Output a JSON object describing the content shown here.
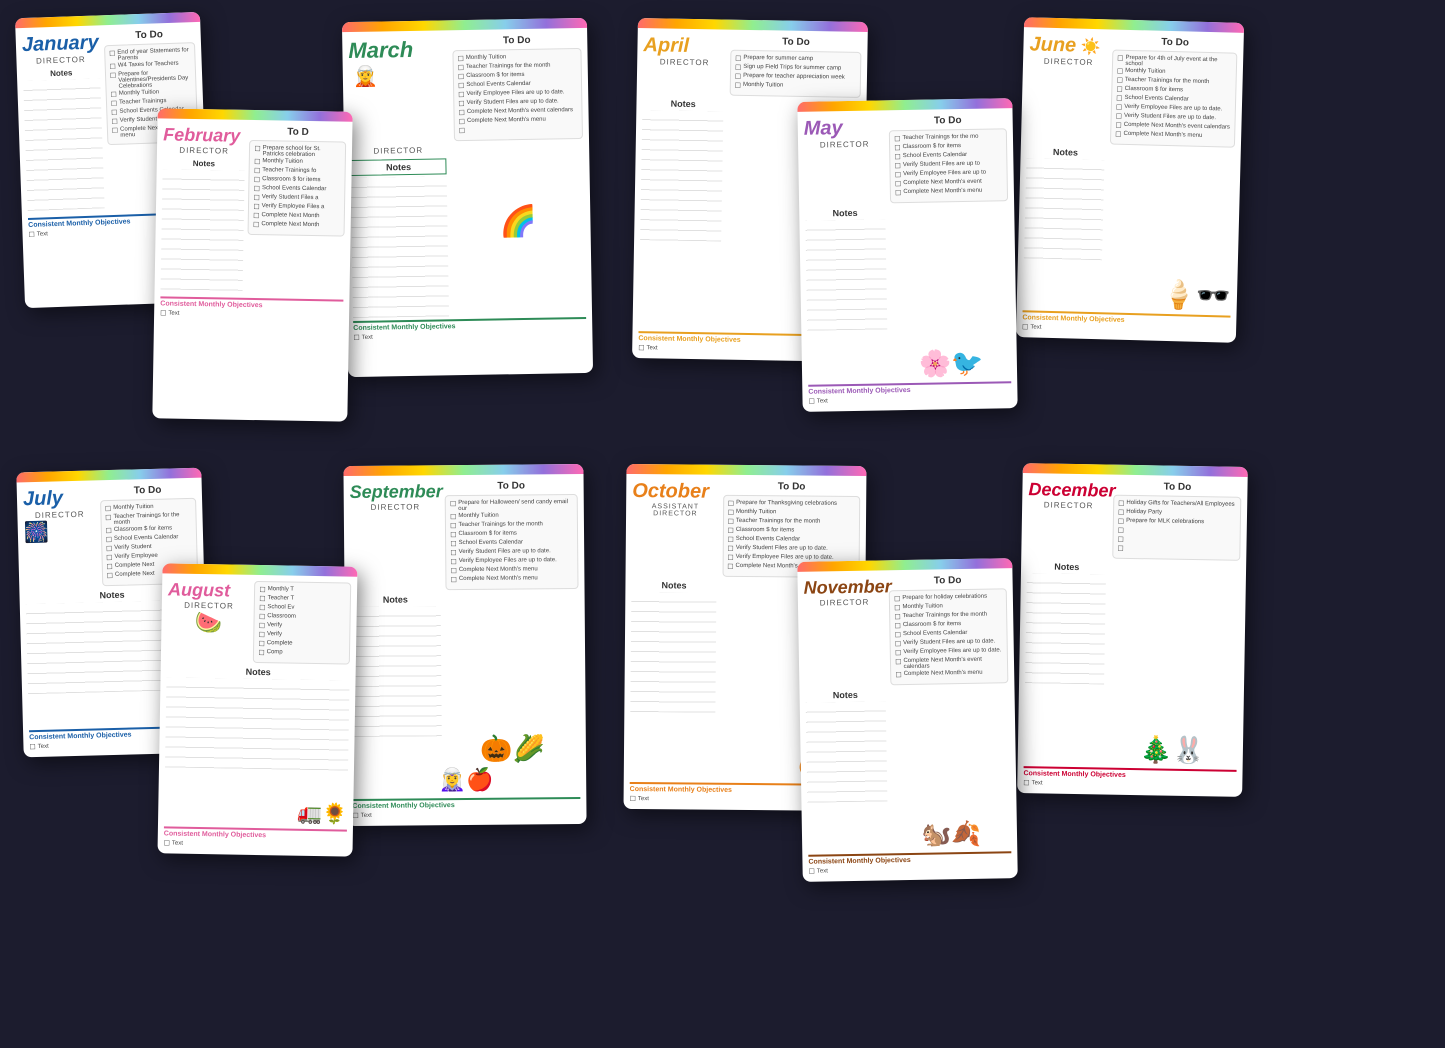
{
  "months": [
    {
      "id": "jan",
      "name": "January",
      "role": "DIRECTOR",
      "color": "#1a5fa8",
      "accent": "jan-accent",
      "objColor": "obj-jan",
      "icon": "❄️",
      "todoItems": [
        "End of year Statements for Parents",
        "W4 Taxes for Teachers",
        "Prepare for Valentines/Presidents Day Celebrations",
        "Monthly Tuition",
        "Teacher Trainings",
        "School Events Calendar",
        "Verify Student Files",
        "Complete Next Month's menu"
      ],
      "objectives": "Text"
    },
    {
      "id": "feb",
      "name": "February",
      "role": "DIRECTOR",
      "color": "#e05c9c",
      "accent": "feb-accent",
      "objColor": "obj-feb",
      "icon": "💕",
      "todoItems": [
        "Prepare school for St. Patrick's Day celebration/black his",
        "Monthly Tuition",
        "Teacher Trainings for",
        "Classroom $ for items",
        "School Events Calendar",
        "Verify Student Files a",
        "Verify Employee Files a",
        "Complete Next Month",
        "Complete Next Month"
      ],
      "objectives": "Text"
    },
    {
      "id": "mar",
      "name": "March",
      "role": "DIRECTOR",
      "color": "#2e8b57",
      "accent": "mar-accent",
      "objColor": "obj-mar",
      "icon": "🍀",
      "todoItems": [
        "Monthly Tuition",
        "Teacher Trainings for the month",
        "Classroom $ for items",
        "School Events Calendar",
        "Verify Employee Files are up to date.",
        "Verify Student Files are up to date.",
        "Complete Next Month's event calendars",
        "Complete Next Month's menu"
      ],
      "objectives": "Text"
    },
    {
      "id": "apr",
      "name": "April",
      "role": "DIRECTOR",
      "color": "#e8a020",
      "accent": "apr-accent",
      "objColor": "obj-apr",
      "icon": "🌸",
      "todoItems": [
        "Prepare for summer camp",
        "Sign up Field Trips for summer camp",
        "Prepare for teacher appreciation week",
        "Monthly Tuition"
      ],
      "objectives": "Text"
    },
    {
      "id": "may",
      "name": "May",
      "role": "DIRECTOR",
      "color": "#9b59b6",
      "accent": "may-accent",
      "objColor": "obj-may",
      "icon": "🌻",
      "todoItems": [
        "Teacher Trainings for the mo",
        "Classroom $ for items",
        "School Events Calendar",
        "Verify Student Files are up to",
        "Verify Employee Files are up to",
        "Complete Next Month's event",
        "Complete Next Month's menu"
      ],
      "objectives": "Text"
    },
    {
      "id": "jun",
      "name": "June",
      "role": "DIRECTOR",
      "color": "#e8a020",
      "accent": "jun-accent",
      "objColor": "obj-jun",
      "icon": "☀️",
      "todoItems": [
        "Prepare for 4th of July event at the school",
        "Monthly Tuition",
        "Teacher Trainings for the month",
        "Classroom $ for items",
        "School Events Calendar",
        "Verify Employee Files are up to date.",
        "Verify Student Files are up to date.",
        "Complete Next Month's event calendars",
        "Complete Next Month's menu"
      ],
      "objectives": "Text"
    },
    {
      "id": "jul",
      "name": "July",
      "role": "DIRECTOR",
      "color": "#1a5fa8",
      "accent": "jul-accent",
      "objColor": "obj-jul",
      "icon": "🎆",
      "todoItems": [
        "Monthly Tuition",
        "Teacher Trainings for the month",
        "Classroom $ for items",
        "School Events Calendar",
        "Verify Student",
        "Verify Employee",
        "Complete Next",
        "Complete Next"
      ],
      "objectives": "Text"
    },
    {
      "id": "aug",
      "name": "August",
      "role": "DIRECTOR",
      "color": "#e05c9c",
      "accent": "aug-accent",
      "objColor": "obj-aug",
      "icon": "🍉",
      "todoItems": [
        "Monthly T",
        "Teacher T",
        "School Ev",
        "Classroom",
        "Verify",
        "Verify",
        "Complete",
        "Comp"
      ],
      "objectives": "Text"
    },
    {
      "id": "sep",
      "name": "September",
      "role": "DIRECTOR",
      "color": "#2e8b57",
      "accent": "sep-accent",
      "objColor": "obj-sep",
      "icon": "🎃",
      "todoItems": [
        "Prepare for Halloween/ send candy email our",
        "Monthly Tuition",
        "Teacher Trainings for the month",
        "Classroom $ for items",
        "School Events Calendar",
        "Verify Student Files are up to date.",
        "Verify Employee Files are up to date.",
        "Complete Next Month's menu",
        "Complete Next Month's menu"
      ],
      "objectives": "Text"
    },
    {
      "id": "oct",
      "name": "October",
      "role": "ASSISTANT DIRECTOR",
      "color": "#e8801a",
      "accent": "oct-accent",
      "objColor": "obj-oct",
      "icon": "🎃",
      "todoItems": [
        "Prepare for Thanksgiving celebrations",
        "Monthly Tuition",
        "Teacher Trainings for the month",
        "Classroom $ for items",
        "School Events Calendar",
        "Verify Student Files are up to date.",
        "Verify Employee Files are up to date.",
        "Complete Next Month's event calendars"
      ],
      "objectives": "Text"
    },
    {
      "id": "nov",
      "name": "November",
      "role": "DIRECTOR",
      "color": "#8B4513",
      "accent": "nov-accent",
      "objColor": "obj-nov",
      "icon": "🍂",
      "todoItems": [
        "Prepare for holiday celebrations",
        "Monthly Tuition",
        "Teacher Trainings for the month",
        "Classroom $ for items",
        "School Events Calendar",
        "Verify Student Files are up to date.",
        "Verify Employee Files are up to date.",
        "Complete Next Month's event calendars",
        "Complete Next Month's menu"
      ],
      "objectives": "Text"
    },
    {
      "id": "dec",
      "name": "December",
      "role": "DIRECTOR",
      "color": "#cc0033",
      "accent": "dec-accent",
      "objColor": "obj-dec",
      "icon": "🎄",
      "todoItems": [
        "Holiday Gifts for Teachers/All Employees",
        "Holiday Party",
        "Prepare for MLK celebrations"
      ],
      "objectives": "Text"
    }
  ],
  "labels": {
    "notes": "Notes",
    "todo": "To Do",
    "objectives": "Consistent Monthly Objectives"
  }
}
